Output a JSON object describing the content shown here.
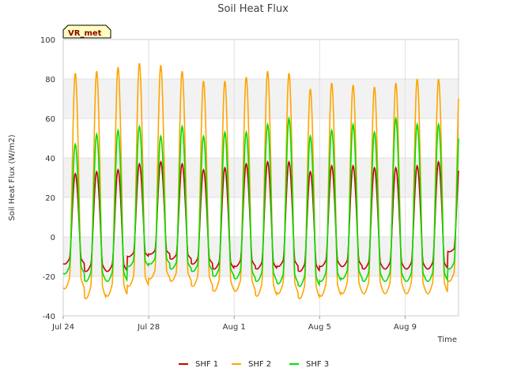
{
  "chart_data": {
    "type": "line",
    "title": "Soil Heat Flux",
    "xlabel": "Time",
    "ylabel": "Soil Heat Flux (W/m2)",
    "badge": "VR_met",
    "ylim": [
      -40,
      100
    ],
    "yticks": [
      -40,
      -20,
      0,
      20,
      40,
      60,
      80,
      100
    ],
    "xlim": [
      "2024-07-24",
      "2024-08-11T12:00"
    ],
    "xticks": [
      {
        "date": "2024-07-24",
        "label": "Jul 24"
      },
      {
        "date": "2024-07-28",
        "label": "Jul 28"
      },
      {
        "date": "2024-08-01",
        "label": "Aug 1"
      },
      {
        "date": "2024-08-05",
        "label": "Aug 5"
      },
      {
        "date": "2024-08-09",
        "label": "Aug 9"
      }
    ],
    "grid": true,
    "legend_position": "bottom-center",
    "days": [
      "2024-07-24",
      "2024-07-25",
      "2024-07-26",
      "2024-07-27",
      "2024-07-28",
      "2024-07-29",
      "2024-07-30",
      "2024-07-31",
      "2024-08-01",
      "2024-08-02",
      "2024-08-03",
      "2024-08-04",
      "2024-08-05",
      "2024-08-06",
      "2024-08-07",
      "2024-08-08",
      "2024-08-09",
      "2024-08-10",
      "2024-08-11"
    ],
    "series": [
      {
        "name": "SHF 1",
        "color": "#cc0000",
        "daily_max": [
          32,
          33,
          34,
          37,
          38,
          37,
          34,
          35,
          37,
          38,
          38,
          33,
          36,
          36,
          35,
          35,
          36,
          38,
          38
        ],
        "daily_min": [
          -11,
          -14,
          -14,
          -8,
          -7,
          -9,
          -11,
          -13,
          -12,
          -13,
          -12,
          -14,
          -12,
          -12,
          -13,
          -13,
          -13,
          -13,
          -6
        ]
      },
      {
        "name": "SHF 2",
        "color": "#ffa500",
        "daily_max": [
          83,
          84,
          86,
          88,
          87,
          84,
          79,
          79,
          81,
          84,
          83,
          75,
          78,
          77,
          76,
          78,
          80,
          80,
          80
        ],
        "daily_min": [
          -21,
          -25,
          -24,
          -20,
          -17,
          -18,
          -20,
          -22,
          -22,
          -24,
          -23,
          -25,
          -24,
          -23,
          -23,
          -23,
          -23,
          -23,
          -18
        ]
      },
      {
        "name": "SHF 3",
        "color": "#00e000",
        "daily_max": [
          47,
          52,
          54,
          56,
          51,
          56,
          51,
          53,
          53,
          57,
          60,
          51,
          54,
          57,
          53,
          60,
          57,
          57,
          57
        ],
        "daily_min": [
          -15,
          -18,
          -18,
          -12,
          -11,
          -13,
          -14,
          -16,
          -17,
          -18,
          -19,
          -20,
          -18,
          -17,
          -18,
          -18,
          -18,
          -18,
          -13
        ]
      }
    ]
  }
}
